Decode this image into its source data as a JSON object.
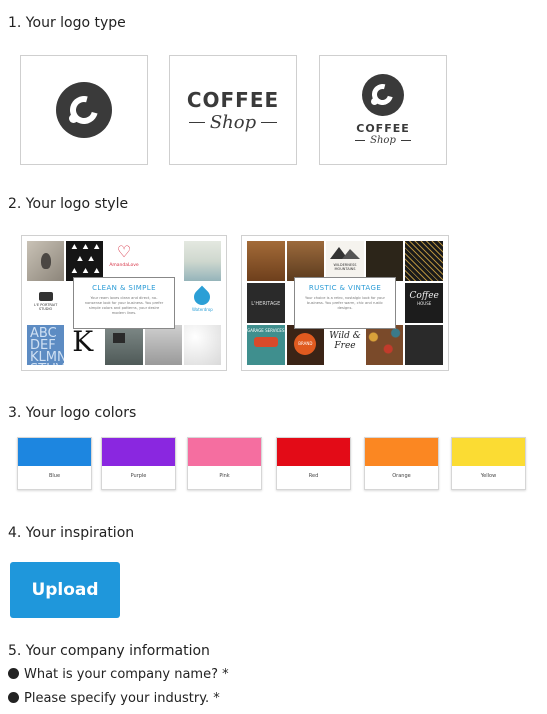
{
  "sections": {
    "logo_type": "1. Your logo type",
    "logo_style": "2. Your logo style",
    "logo_colors": "3. Your logo colors",
    "inspiration": "4. Your inspiration",
    "company_info": "5. Your company information"
  },
  "logo_types": {
    "wordmark": {
      "line1": "COFFEE",
      "line2": "Shop"
    },
    "combination": {
      "line1": "COFFEE",
      "line2": "Shop"
    }
  },
  "logo_styles": [
    {
      "title": "CLEAN & SIMPLE",
      "description": "Your ream loves clean and direct, no-nonsense look for your business. You prefer simple colors and patterns, your desire modern lines.",
      "tile_texts": {
        "brand1": "AmandaLove",
        "studio": "L'E PORTRAIT STUDIO",
        "letters": "ABC DEF KLMN STUV",
        "k": "K",
        "waterdrop": "Waterdrop"
      }
    },
    {
      "title": "RUSTIC & VINTAGE",
      "description": "Your choice is a retro, nostalgic look for your business. You prefer warm, chic and rustic designs.",
      "tile_texts": {
        "wilderness": "WILDERNESS MOUNTAINS",
        "heritage": "L'HERITAGE",
        "garage": "GARAGE SERVICES",
        "brand": "BRAND",
        "wild": "Wild & Free",
        "coffee": "Coffee",
        "house": "HOUSE"
      }
    }
  ],
  "colors": [
    {
      "name": "Blue",
      "hex": "#1d86e0"
    },
    {
      "name": "Purple",
      "hex": "#8a27e0"
    },
    {
      "name": "Pink",
      "hex": "#f56ea0"
    },
    {
      "name": "Red",
      "hex": "#e30b17"
    },
    {
      "name": "Orange",
      "hex": "#fb8722"
    },
    {
      "name": "Yellow",
      "hex": "#fbdc33"
    }
  ],
  "upload": {
    "label": "Upload"
  },
  "questions": [
    {
      "text": "What is your company name? *"
    },
    {
      "text": "Please specify your industry. *"
    }
  ]
}
